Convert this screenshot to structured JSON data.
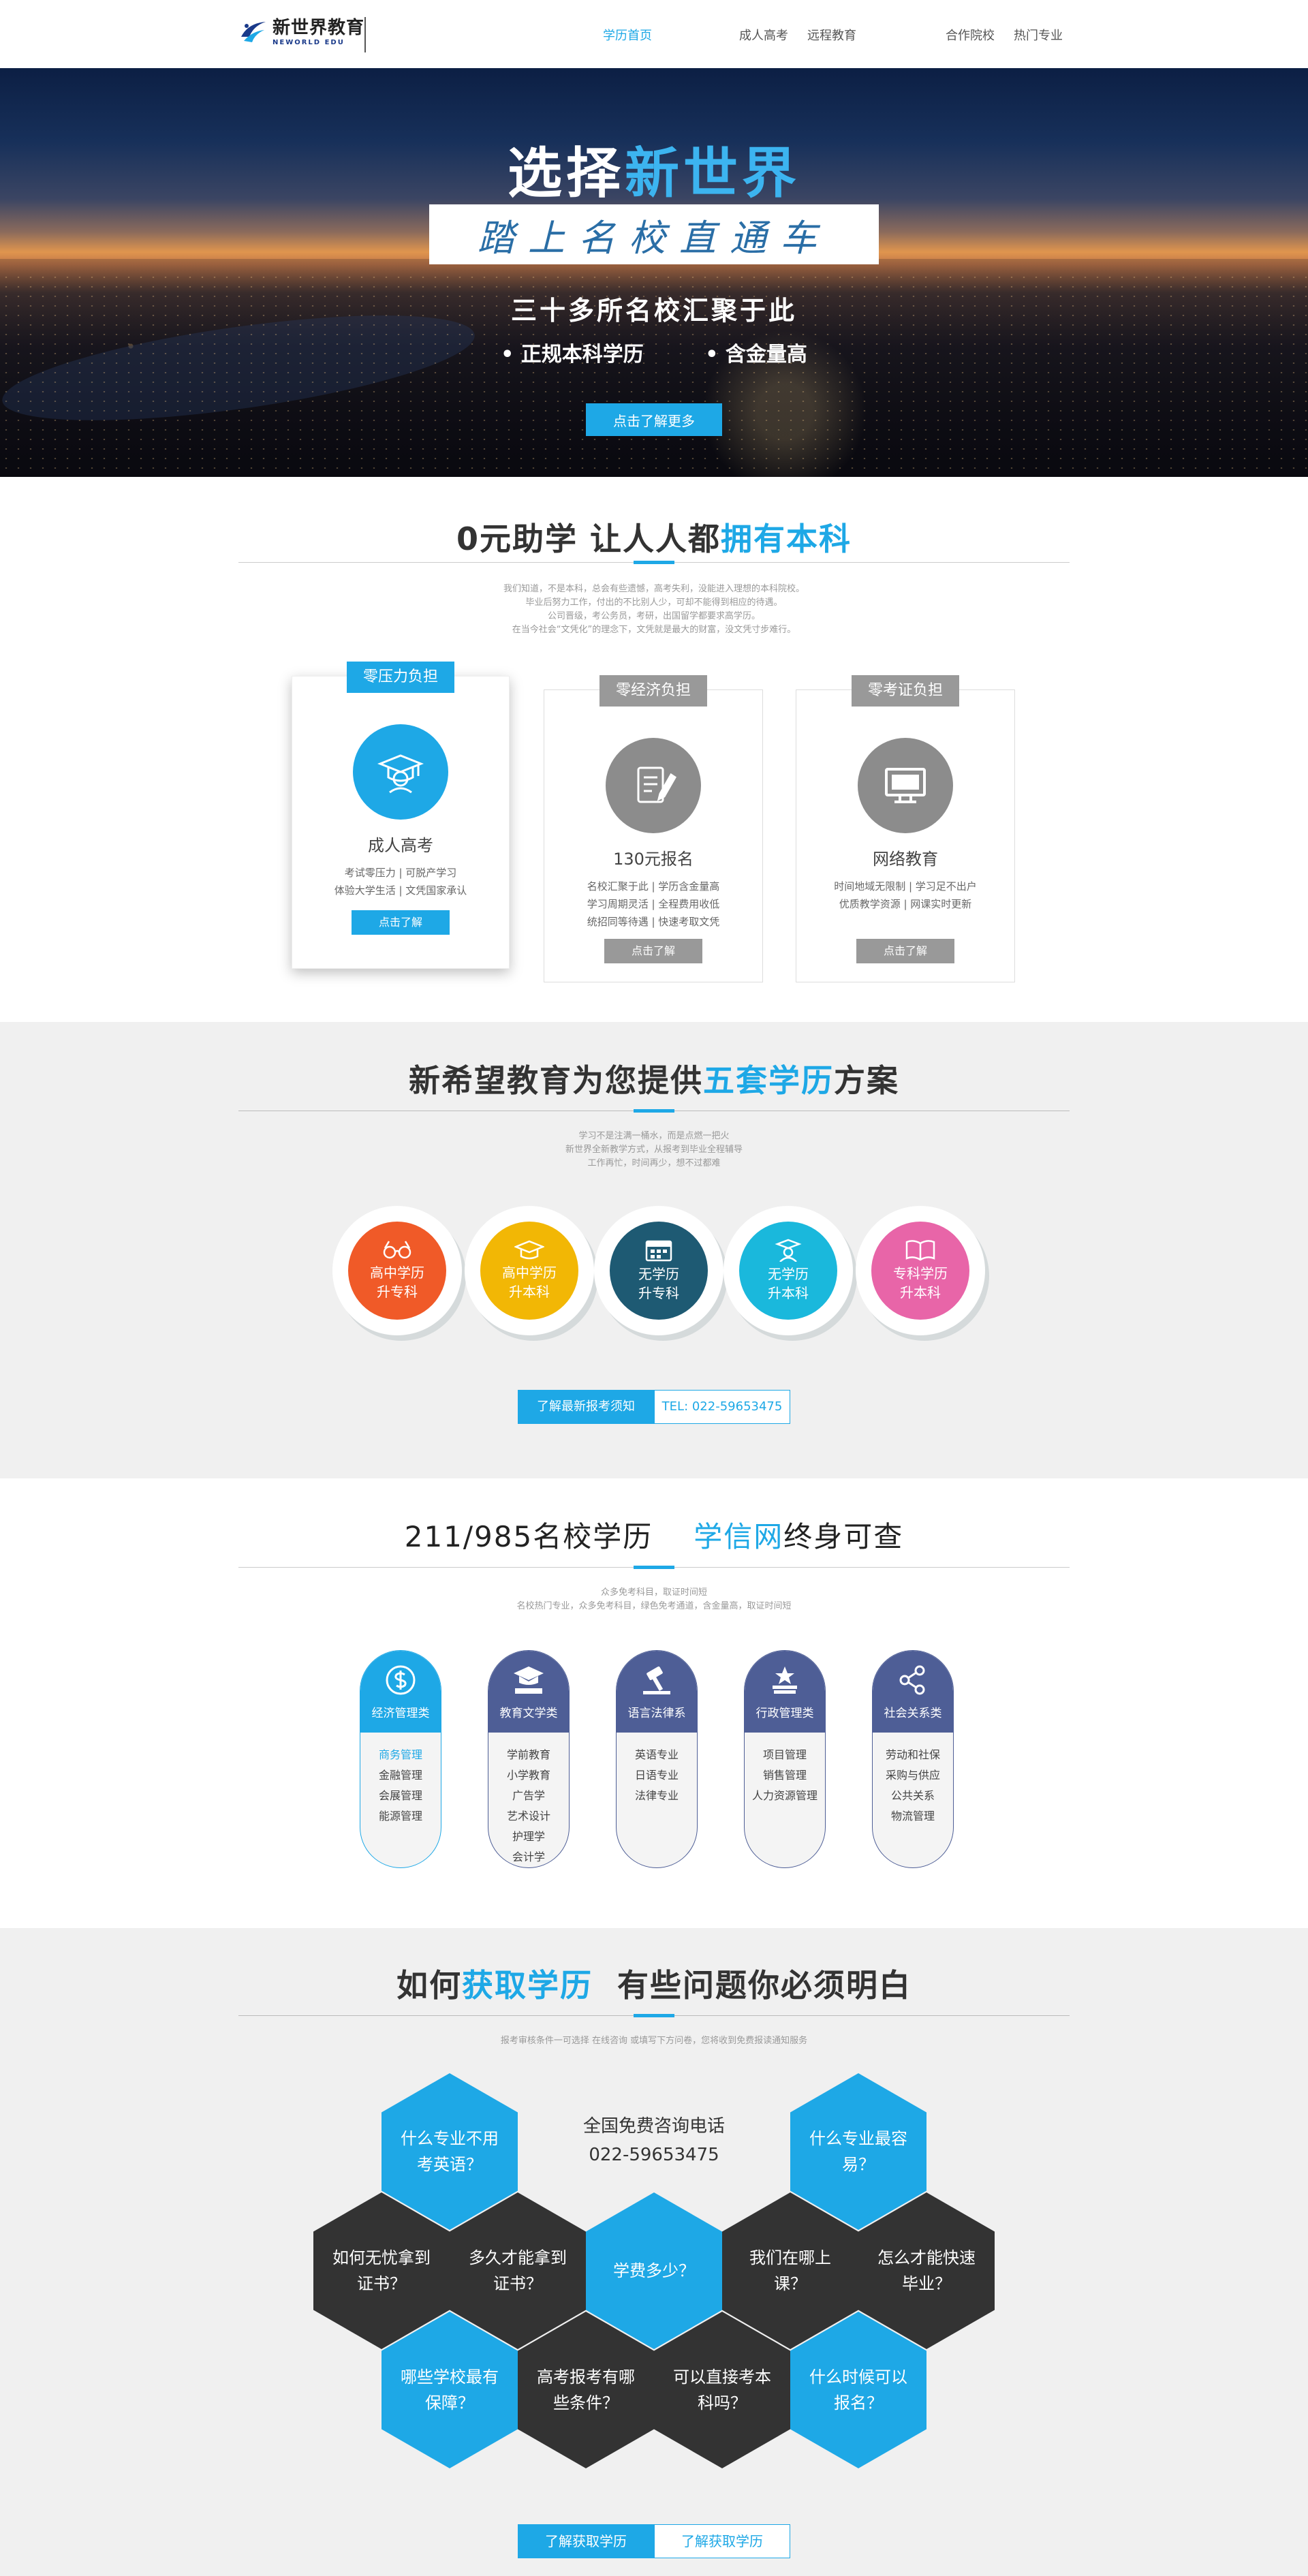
{
  "header": {
    "logo_cn": "新世界教育",
    "logo_en": "NEWORLD EDU",
    "nav": [
      "学历首页",
      "成人高考",
      "远程教育",
      "合作院校",
      "热门专业"
    ]
  },
  "hero": {
    "title_a": "选择",
    "title_b": "新世界",
    "slogan": "踏上名校直通车",
    "sub": "三十多所名校汇聚于此",
    "bullet1": "• 正规本科学历",
    "bullet2": "• 含金量高",
    "button": "点击了解更多"
  },
  "s1": {
    "title_a": "0元助学  让人人都",
    "title_b": "拥有本科",
    "desc": [
      "我们知道，不是本科，总会有些遗憾，高考失利，没能进入理想的本科院校。",
      "毕业后努力工作，付出的不比别人少，可却不能得到相应的待遇。",
      "公司晋级，考公务员，考研，出国留学都要求高学历。",
      "在当今社会“文凭化”的理念下，文凭就是最大的财富，没文凭寸步难行。"
    ],
    "cards": [
      {
        "tag": "零压力负担",
        "name": "成人高考",
        "desc": [
          "考试零压力 | 可脱产学习",
          "体验大学生活 | 文凭国家承认"
        ],
        "button": "点击了解"
      },
      {
        "tag": "零经济负担",
        "name": "130元报名",
        "desc": [
          "名校汇聚于此 | 学历含金量高",
          "学习周期灵活 | 全程费用收低",
          "统招同等待遇 | 快速考取文凭"
        ],
        "button": "点击了解"
      },
      {
        "tag": "零考证负担",
        "name": "网络教育",
        "desc": [
          "时间地域无限制 | 学习足不出户",
          "优质教学资源 | 网课实时更新"
        ],
        "button": "点击了解"
      }
    ]
  },
  "s2": {
    "title_a": "新希望教育为您提供",
    "title_b": "五套学历",
    "title_c": "方案",
    "desc": [
      "学习不是注满一桶水，而是点燃一把火",
      "新世界全新教学方式，从报考到毕业全程辅导",
      "工作再忙，时间再少，想不过都难"
    ],
    "plans": [
      {
        "l1": "高中学历",
        "l2": "升专科",
        "color": "#f05a28"
      },
      {
        "l1": "高中学历",
        "l2": "升本科",
        "color": "#f2b705"
      },
      {
        "l1": "无学历",
        "l2": "升专科",
        "color": "#1e5a73"
      },
      {
        "l1": "无学历",
        "l2": "升本科",
        "color": "#1ab8dc"
      },
      {
        "l1": "专科学历",
        "l2": "升本科",
        "color": "#e865a8"
      }
    ],
    "btn_left": "了解最新报考须知",
    "btn_right": "TEL: 022-59653475"
  },
  "s3": {
    "title_a": "211/985名校学历",
    "title_b": "学信网",
    "title_c": "终身可查",
    "desc": [
      "众多免考科目，取证时间短",
      "名校热门专业，众多免考科目，绿色免考通道，含金量高，取证时间短"
    ],
    "majors": [
      {
        "head": "经济管理类",
        "color": "#1ea8e6",
        "items": [
          "商务管理",
          "金融管理",
          "会展管理",
          "能源管理"
        ]
      },
      {
        "head": "教育文学类",
        "color": "#4e5e96",
        "items": [
          "学前教育",
          "小学教育",
          "广告学",
          "艺术设计",
          "护理学",
          "会计学"
        ]
      },
      {
        "head": "语言法律系",
        "color": "#4e5e96",
        "items": [
          "英语专业",
          "日语专业",
          "法律专业"
        ]
      },
      {
        "head": "行政管理类",
        "color": "#4e5e96",
        "items": [
          "项目管理",
          "销售管理",
          "人力资源管理"
        ]
      },
      {
        "head": "社会关系类",
        "color": "#4e5e96",
        "items": [
          "劳动和社保",
          "采购与供应",
          "公共关系",
          "物流管理"
        ]
      }
    ]
  },
  "s4": {
    "title_a": "如何",
    "title_b": "获取学历",
    "title_c": "  有些问题你必须明白",
    "desc": "报考审核条件一可选择 在线咨询 或填写下方问卷，您将收到免费报读通知服务",
    "phone_label": "全国免费咨询电话",
    "phone": "022-59653475",
    "hexes": [
      "什么专业不用考英语？",
      "什么专业最容易？",
      "如何无忧拿到证书？",
      "多久才能拿到证书？",
      "学费多少？",
      "我们在哪上课？",
      "怎么才能快速毕业？",
      "哪些学校最有保障？",
      "高考报考有哪些条件？",
      "可以直接考本科吗？",
      "什么时候可以报名？"
    ],
    "btn_left": "了解获取学历",
    "btn_right": "了解获取学历"
  }
}
